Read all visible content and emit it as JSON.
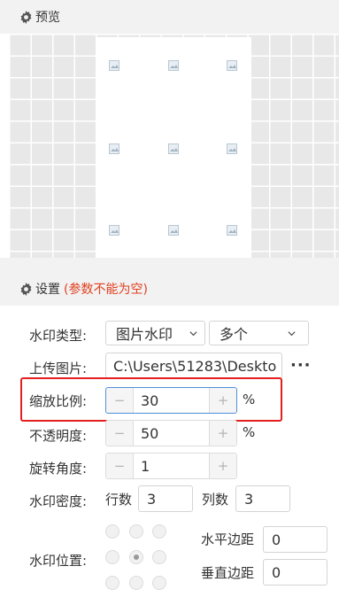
{
  "preview": {
    "title": "预览"
  },
  "settings": {
    "title": "设置",
    "note": "(参数不能为空)",
    "watermark_type": {
      "label": "水印类型:",
      "type_value": "图片水印",
      "count_value": "多个"
    },
    "upload": {
      "label": "上传图片:",
      "path": "C:\\Users\\51283\\Deskto",
      "more": "···"
    },
    "scale": {
      "label": "缩放比例:",
      "value": "30",
      "unit": "%",
      "minus": "−",
      "plus": "+"
    },
    "opacity": {
      "label": "不透明度:",
      "value": "50",
      "unit": "%",
      "minus": "−",
      "plus": "+"
    },
    "rotation": {
      "label": "旋转角度:",
      "value": "1",
      "minus": "−",
      "plus": "+"
    },
    "density": {
      "label": "水印密度:",
      "rows_label": "行数",
      "rows_value": "3",
      "cols_label": "列数",
      "cols_value": "3"
    },
    "position": {
      "label": "水印位置:",
      "selected": "center",
      "h_margin_label": "水平边距",
      "h_margin_value": "0",
      "v_margin_label": "垂直边距",
      "v_margin_value": "0"
    }
  },
  "colors": {
    "note_red": "#e0401f",
    "highlight_red": "#e41e1e",
    "focus_blue": "#4d90d8"
  }
}
